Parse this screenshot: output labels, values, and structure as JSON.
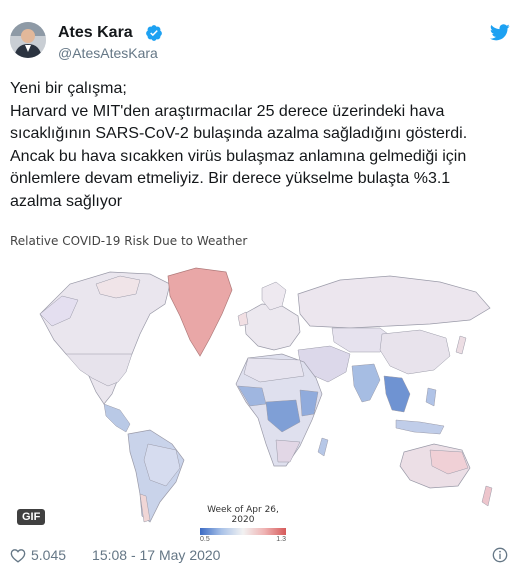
{
  "author": {
    "name": "Ates Kara",
    "handle": "@AtesAtesKara",
    "verified": true
  },
  "tweet_lines": [
    "Yeni bir çalışma;",
    "Harvard ve MIT'den araştırmacılar 25 derece üzerindeki hava",
    "sıcaklığının SARS-CoV-2 bulaşında azalma sağladığını gösterdi.",
    "Ancak bu hava sıcakken virüs bulaşmaz anlamına gelmediği için",
    "önlemlere devam etmeliyiz. Bir derece yükselme bulaşta %3.1",
    "azalma sağlıyor"
  ],
  "media": {
    "title": "Relative COVID-19 Risk Due to Weather",
    "badge": "GIF",
    "legend_title": "Week of Apr 26, 2020",
    "legend_min": "0.5",
    "legend_max": "1.3"
  },
  "footer": {
    "likes": "5.045",
    "timestamp": "15:08 - 17 May 2020"
  },
  "icons": {
    "verified": "verified-badge-icon",
    "twitter": "twitter-bird-icon",
    "like": "heart-icon",
    "info": "info-icon"
  },
  "colors": {
    "brand": "#1da1f2",
    "text": "#14171a",
    "secondary": "#657786",
    "risk_low": "#3c6bc4",
    "risk_high": "#d65a5a"
  }
}
